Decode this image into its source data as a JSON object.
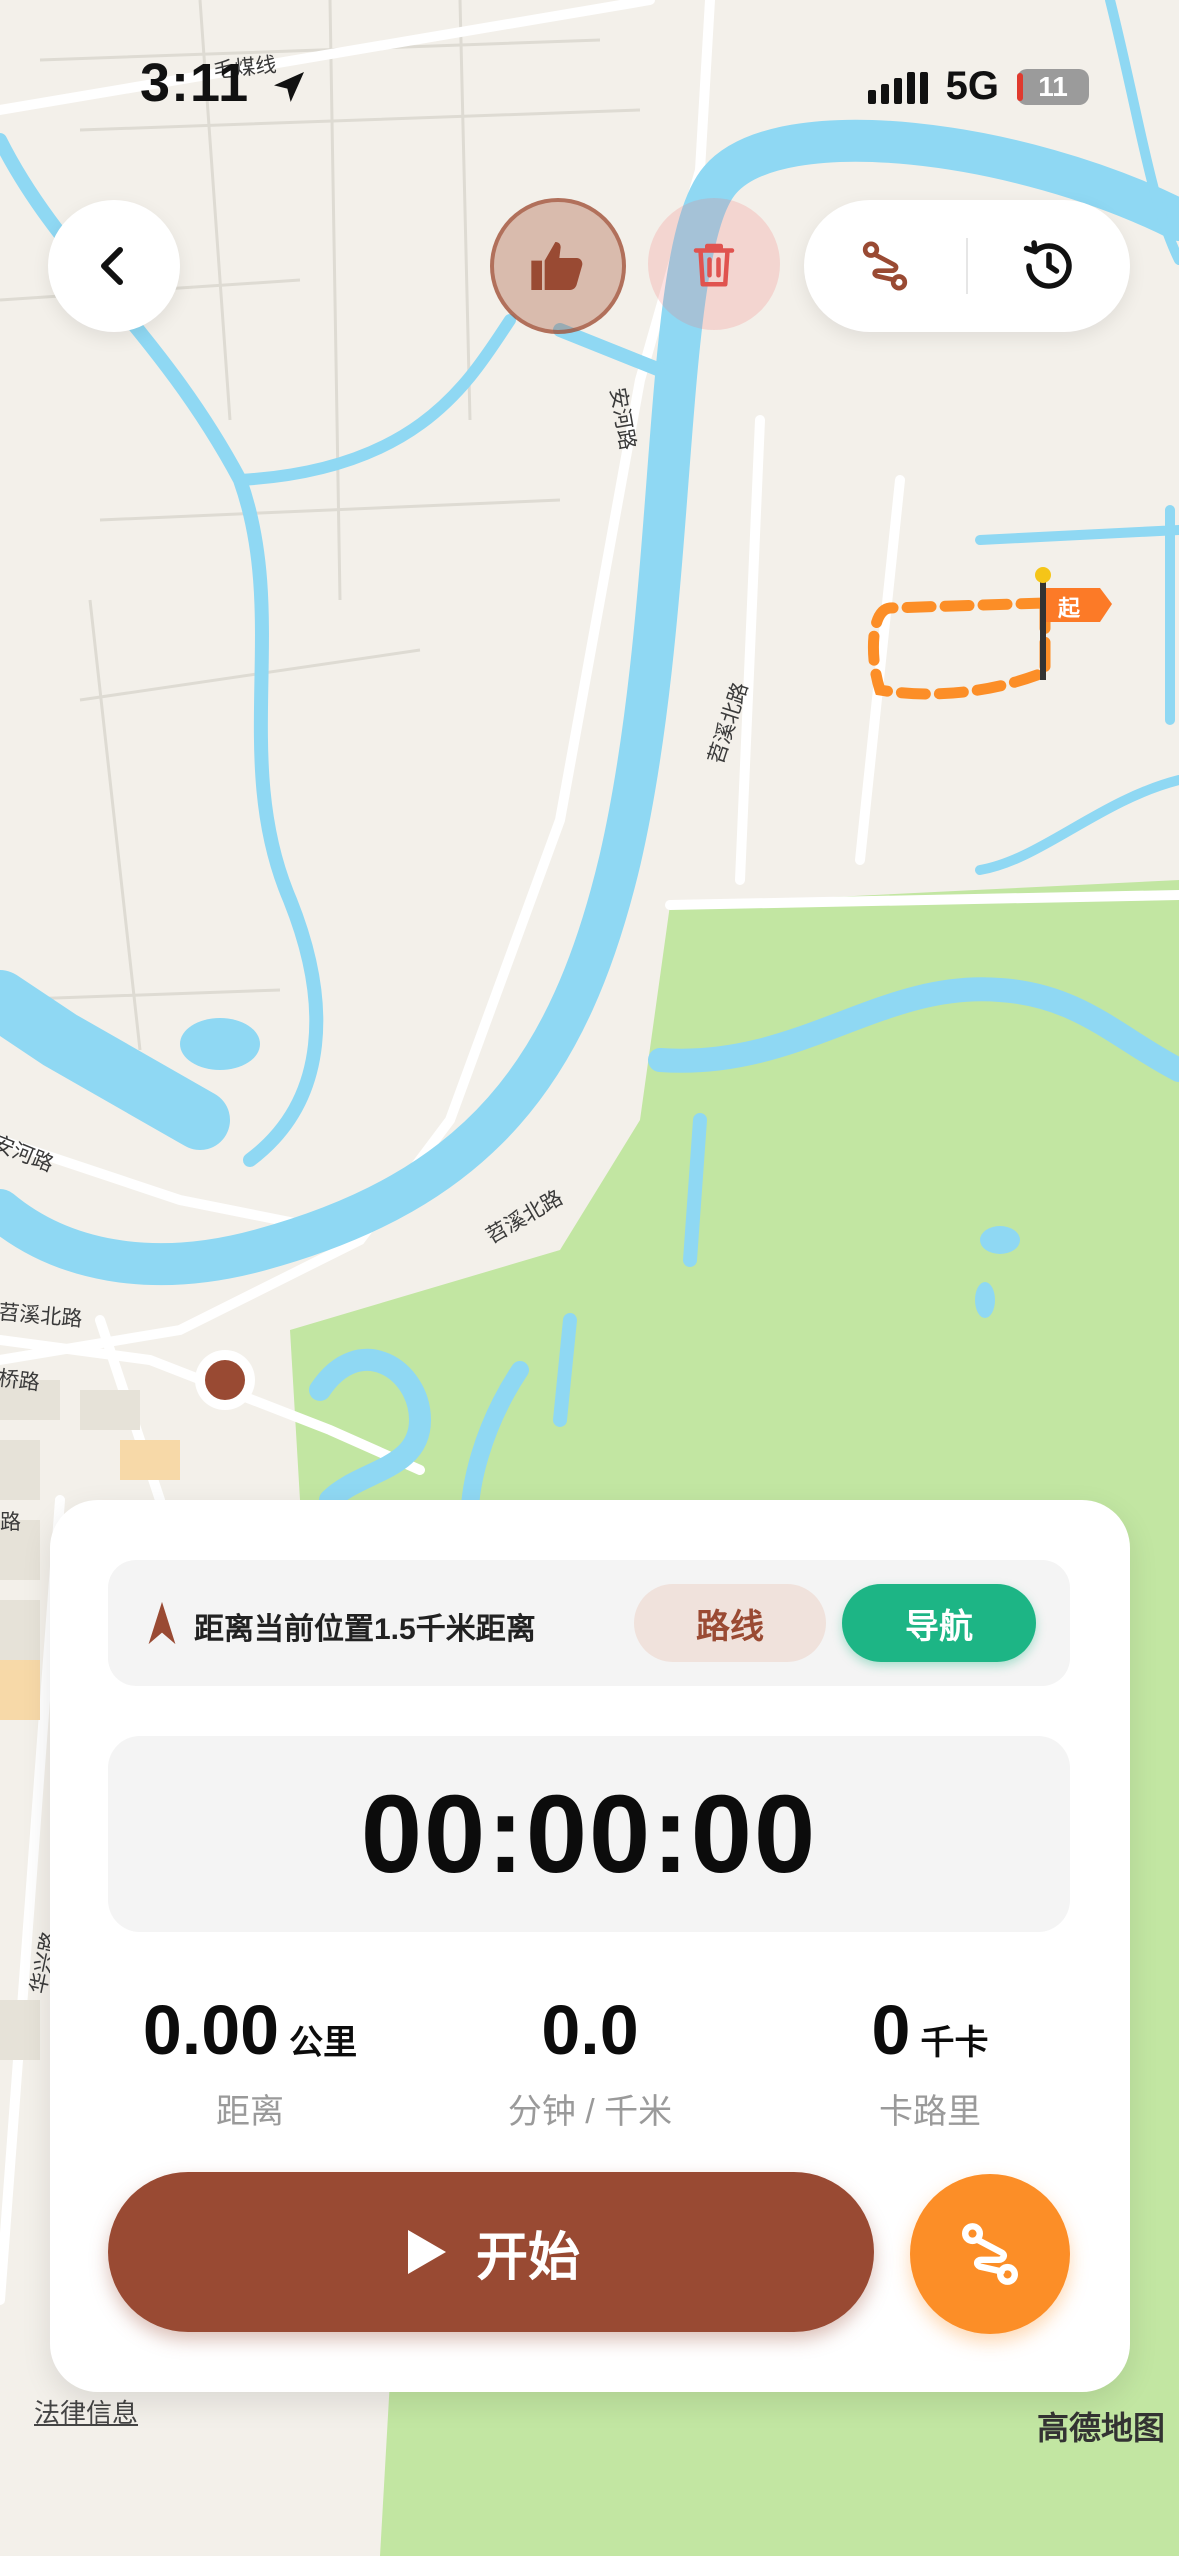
{
  "status_bar": {
    "time": "3:11",
    "network": "5G",
    "battery": "11",
    "icons": [
      "location-arrow-icon",
      "signal-icon",
      "battery-icon"
    ]
  },
  "toolbar": {
    "back_icon": "chevron-left-icon",
    "like_icon": "thumbs-up-icon",
    "delete_icon": "trash-icon",
    "route_icon": "route-icon",
    "history_icon": "history-icon"
  },
  "map": {
    "roads": [
      "毛煤线",
      "安河路",
      "苕溪北路",
      "苕溪北路",
      "安河路",
      "苕溪北路",
      "桥路",
      "路",
      "华兴路"
    ],
    "start_flag": "起",
    "legal": "法律信息",
    "provider": "高德地图",
    "colors": {
      "water": "#8fd8f3",
      "park": "#c2e6a2",
      "land": "#f3f0ea",
      "road": "#ffffff",
      "track": "#fc8e27"
    }
  },
  "panel": {
    "distance_info": "距离当前位置1.5千米距离",
    "route_button": "路线",
    "nav_button": "导航",
    "timer": "00:00:00",
    "stats": [
      {
        "value": "0.00",
        "unit": "公里",
        "label": "距离"
      },
      {
        "value": "0.0",
        "unit": "",
        "label": "分钟 / 千米"
      },
      {
        "value": "0",
        "unit": "千卡",
        "label": "卡路里"
      }
    ],
    "start_button": "开始",
    "colors": {
      "primary": "#994a33",
      "nav": "#1db585",
      "fab": "#fc8e27"
    }
  }
}
